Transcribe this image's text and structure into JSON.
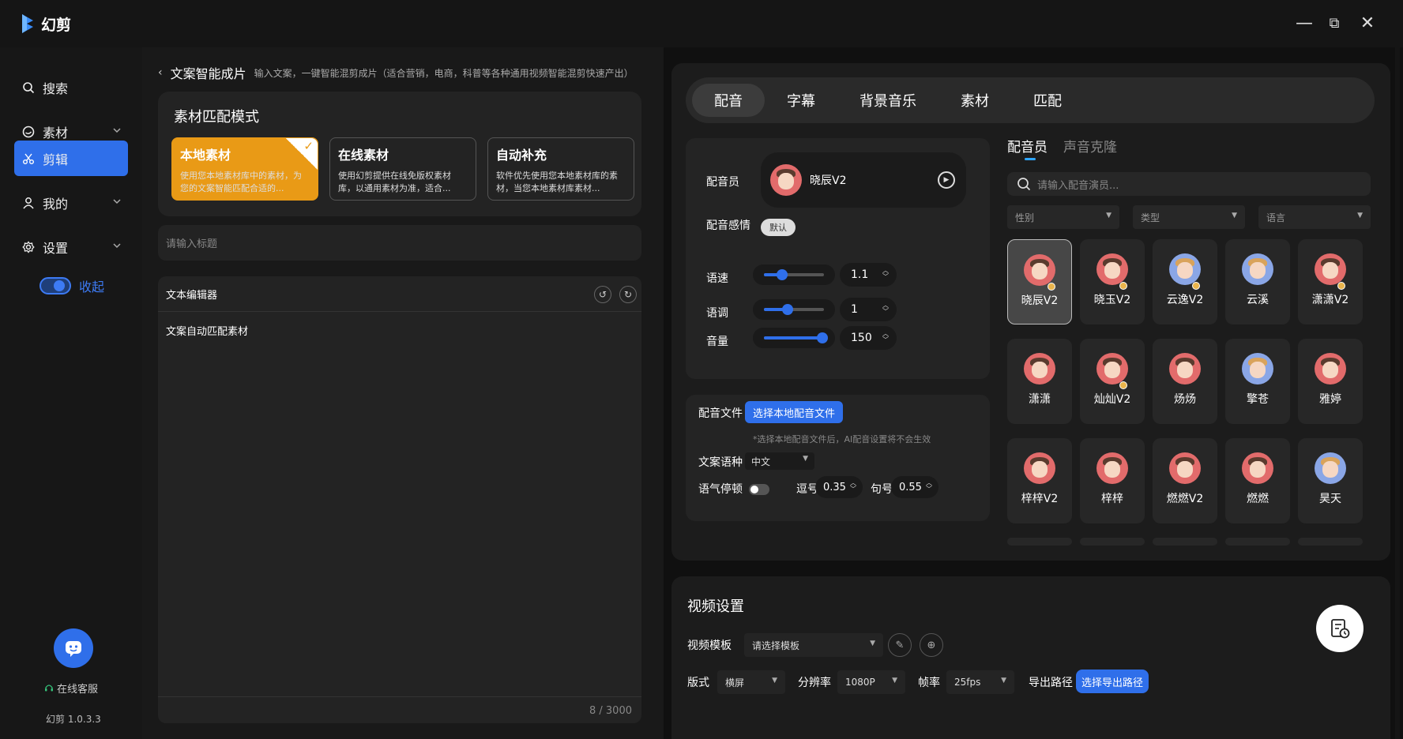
{
  "app": {
    "name": "幻剪"
  },
  "window_controls": {
    "minimize": "—",
    "maximize": "⧉",
    "close": "✕"
  },
  "sidebar": {
    "items": [
      {
        "label": "搜索",
        "icon": "search-icon"
      },
      {
        "label": "素材",
        "icon": "material-icon"
      },
      {
        "label": "剪辑",
        "icon": "scissors-icon"
      },
      {
        "label": "我的",
        "icon": "user-icon"
      },
      {
        "label": "设置",
        "icon": "gear-icon"
      }
    ],
    "collapse_label": "收起",
    "customer_service": "在线客服",
    "version": "幻剪 1.0.3.3"
  },
  "left": {
    "breadcrumb_title": "文案智能成片",
    "breadcrumb_desc": "输入文案，一键智能混剪成片（适合营销，电商，科普等各种通用视频智能混剪快速产出）",
    "match_mode_title": "素材匹配模式",
    "modes": [
      {
        "title": "本地素材",
        "desc": "使用您本地素材库中的素材，为您的文案智能匹配合适的...",
        "selected": true
      },
      {
        "title": "在线素材",
        "desc": "使用幻剪提供在线免版权素材库，以通用素材为准，适合...",
        "selected": false
      },
      {
        "title": "自动补充",
        "desc": "软件优先使用您本地素材库的素材，当您本地素材库素材...",
        "selected": false
      }
    ],
    "title_placeholder": "请输入标题",
    "editor_title": "文本编辑器",
    "editor_text": "文案自动匹配素材",
    "counter": "8 / 3000"
  },
  "right": {
    "tabs": [
      {
        "label": "配音",
        "active": true
      },
      {
        "label": "字幕",
        "active": false
      },
      {
        "label": "背景音乐",
        "active": false
      },
      {
        "label": "素材",
        "active": false
      },
      {
        "label": "匹配",
        "active": false
      }
    ],
    "voice": {
      "voice_label": "配音员",
      "selected_voice": "晓辰V2",
      "emotion_label": "配音感情",
      "emotion_value": "默认",
      "speed_label": "语速",
      "speed_value": "1.1",
      "speed_level": 0.3,
      "pitch_label": "语调",
      "pitch_value": "1",
      "pitch_level": 0.4,
      "volume_label": "音量",
      "volume_value": "150",
      "volume_level": 0.97
    },
    "file": {
      "label": "配音文件",
      "button": "选择本地配音文件",
      "hint": "*选择本地配音文件后，AI配音设置将不会生效",
      "lang_label": "文案语种",
      "lang_value": "中文",
      "pause_label": "语气停顿",
      "comma_label": "逗号",
      "comma_value": "0.35",
      "period_label": "句号",
      "period_value": "0.55"
    },
    "subtabs": [
      {
        "label": "配音员",
        "active": true
      },
      {
        "label": "声音克隆",
        "active": false
      }
    ],
    "search_placeholder": "请输入配音演员...",
    "filters": [
      "性别",
      "类型",
      "语言"
    ],
    "voices": [
      {
        "name": "晓辰V2",
        "selected": true,
        "badge": true,
        "color": "red"
      },
      {
        "name": "晓玉V2",
        "selected": false,
        "badge": true,
        "color": "red"
      },
      {
        "name": "云逸V2",
        "selected": false,
        "badge": true,
        "color": "blue"
      },
      {
        "name": "云溪",
        "selected": false,
        "badge": false,
        "color": "blue"
      },
      {
        "name": "潇潇V2",
        "selected": false,
        "badge": true,
        "color": "red"
      },
      {
        "name": "潇潇",
        "selected": false,
        "badge": false,
        "color": "red"
      },
      {
        "name": "灿灿V2",
        "selected": false,
        "badge": true,
        "color": "red"
      },
      {
        "name": "炀炀",
        "selected": false,
        "badge": false,
        "color": "red"
      },
      {
        "name": "擎苍",
        "selected": false,
        "badge": false,
        "color": "blue"
      },
      {
        "name": "雅婷",
        "selected": false,
        "badge": false,
        "color": "red"
      },
      {
        "name": "梓梓V2",
        "selected": false,
        "badge": false,
        "color": "red"
      },
      {
        "name": "梓梓",
        "selected": false,
        "badge": false,
        "color": "red"
      },
      {
        "name": "燃燃V2",
        "selected": false,
        "badge": false,
        "color": "red"
      },
      {
        "name": "燃燃",
        "selected": false,
        "badge": false,
        "color": "red"
      },
      {
        "name": "昊天",
        "selected": false,
        "badge": false,
        "color": "blue"
      }
    ]
  },
  "video": {
    "title": "视频设置",
    "template_label": "视频模板",
    "template_placeholder": "请选择模板",
    "layout_label": "版式",
    "layout_value": "横屏",
    "resolution_label": "分辨率",
    "resolution_value": "1080P",
    "fps_label": "帧率",
    "fps_value": "25fps",
    "export_label": "导出路径",
    "export_button": "选择导出路径"
  },
  "colors": {
    "accent": "#2f6fea",
    "selected_mode": "#e99a16",
    "background": "#101010"
  }
}
